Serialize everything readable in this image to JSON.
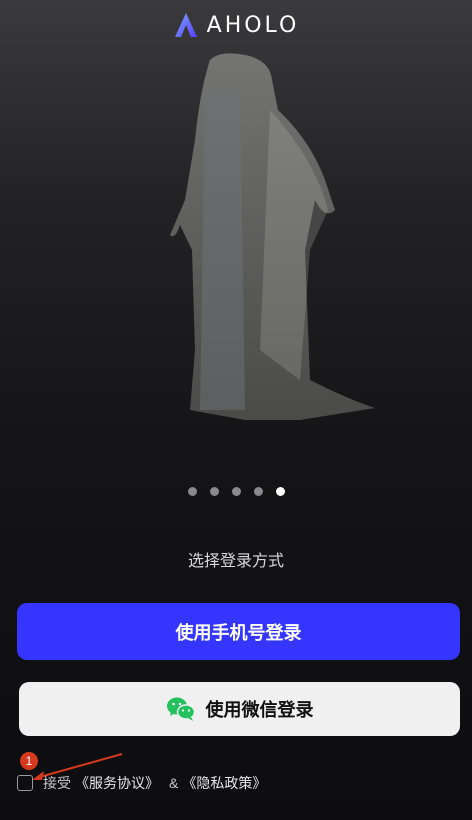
{
  "brand": {
    "name": "AHOLO",
    "accent": "#6a5cff"
  },
  "carousel": {
    "total": 5,
    "active_index": 4
  },
  "login": {
    "prompt": "选择登录方式",
    "phone_button": "使用手机号登录",
    "wechat_button": "使用微信登录"
  },
  "agreement": {
    "accept": "接受",
    "service": "《服务协议》",
    "amp": "&",
    "privacy": "《隐私政策》",
    "checked": false
  },
  "annotation": {
    "badge": "1"
  },
  "icons": [
    "aholo-logo-icon",
    "wechat-icon",
    "checkbox-icon",
    "arrow-annotation-icon"
  ]
}
